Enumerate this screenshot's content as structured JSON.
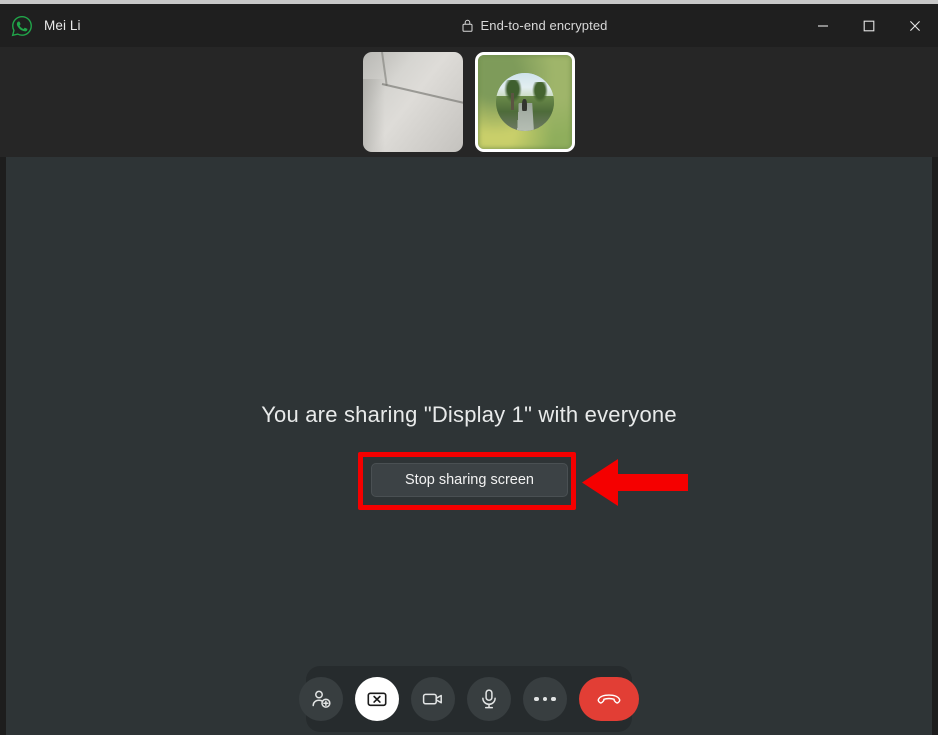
{
  "window": {
    "contact_name": "Mei Li",
    "encryption_label": "End-to-end encrypted",
    "lock_icon": "lock-icon",
    "app_icon": "whatsapp-logo-icon",
    "controls": {
      "minimize": "minimize-icon",
      "maximize": "maximize-icon",
      "close": "close-icon"
    }
  },
  "thumbnails": [
    {
      "name": "self-video-thumbnail",
      "active": false,
      "description": "ceiling corner camera view"
    },
    {
      "name": "participant-video-thumbnail",
      "active": true,
      "description": "blurred green background with circular avatar"
    }
  ],
  "stage": {
    "share_message": "You are sharing \"Display 1\" with everyone",
    "stop_share_label": "Stop sharing screen"
  },
  "annotations": {
    "highlight_color": "#f50000",
    "box_target": "stop-sharing-screen-button",
    "arrow_direction": "left"
  },
  "call_controls": [
    {
      "name": "add-participant-button",
      "icon": "person-add-icon",
      "state": "default"
    },
    {
      "name": "stop-screen-share-button",
      "icon": "screen-share-off-icon",
      "state": "active"
    },
    {
      "name": "toggle-camera-button",
      "icon": "video-camera-icon",
      "state": "default"
    },
    {
      "name": "toggle-microphone-button",
      "icon": "microphone-icon",
      "state": "default"
    },
    {
      "name": "more-options-button",
      "icon": "ellipsis-icon",
      "state": "default"
    },
    {
      "name": "end-call-button",
      "icon": "phone-hangup-icon",
      "state": "danger"
    }
  ],
  "colors": {
    "title_bar": "#1f1f1f",
    "thumb_strip": "#262626",
    "stage": "#2e3436",
    "button": "#3c4245",
    "end_call": "#e23e35",
    "accent_red": "#f50000"
  }
}
